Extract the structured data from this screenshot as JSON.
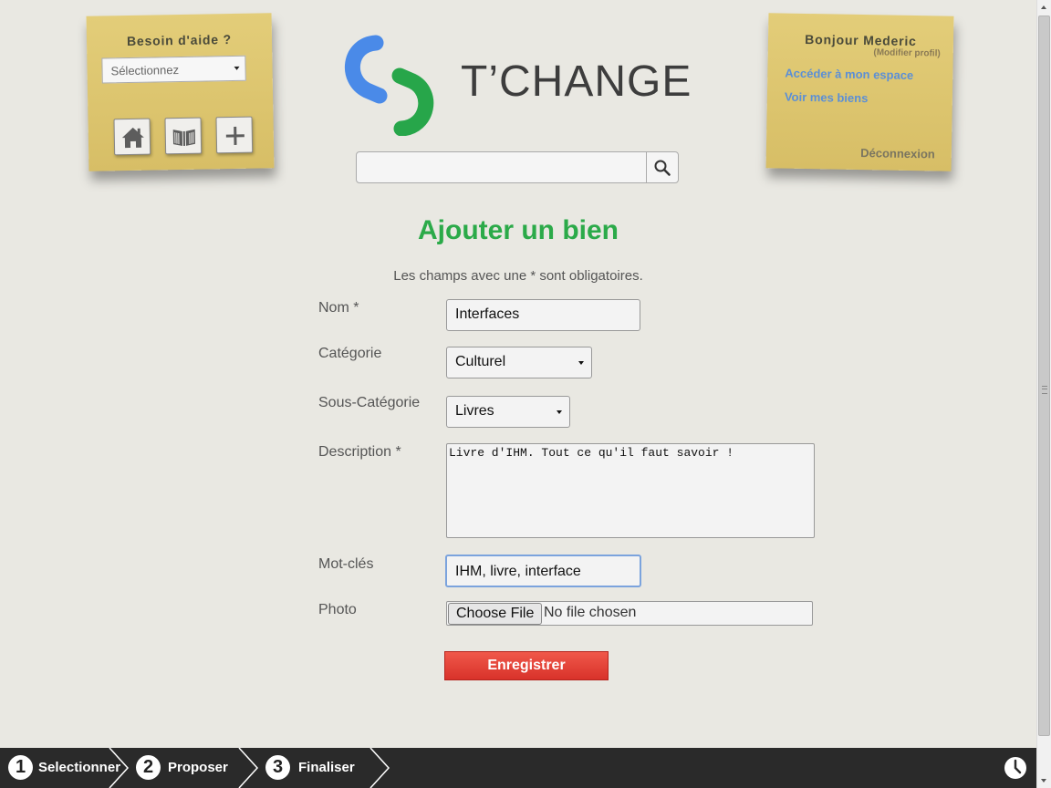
{
  "help_note": {
    "title": "Besoin d'aide ?",
    "select_value": "Sélectionnez",
    "icons": [
      "home-icon",
      "library-icon",
      "add-icon"
    ]
  },
  "user_note": {
    "greeting": "Bonjour Mederic",
    "edit_profile": "(Modifier profil)",
    "link_space": "Accéder à mon espace",
    "link_goods": "Voir mes biens",
    "logout": "Déconnexion"
  },
  "brand": {
    "name": "T’CHANGE",
    "colors": {
      "blue": "#4a8ae8",
      "green": "#27a64a",
      "text": "#3d3d3d"
    }
  },
  "search": {
    "value": ""
  },
  "form": {
    "title": "Ajouter un bien",
    "required_note": "Les champs avec une * sont obligatoires.",
    "name_label": "Nom *",
    "name_value": "Interfaces",
    "category_label": "Catégorie",
    "category_value": "Culturel",
    "subcategory_label": "Sous-Catégorie",
    "subcategory_value": "Livres",
    "description_label": "Description *",
    "description_value": "Livre d'IHM. Tout ce qu'il faut savoir !",
    "keywords_label": "Mot-clés",
    "keywords_value": "IHM, livre, interface",
    "photo_label": "Photo",
    "file_button": "Choose File",
    "file_status": "No file chosen",
    "save_button": "Enregistrer",
    "title_color": "#2baa49",
    "save_color": "#e5443a"
  },
  "footer": {
    "steps": [
      {
        "number": "1",
        "label": "Selectionner"
      },
      {
        "number": "2",
        "label": "Proposer"
      },
      {
        "number": "3",
        "label": "Finaliser"
      }
    ],
    "icon": "clock-icon"
  }
}
